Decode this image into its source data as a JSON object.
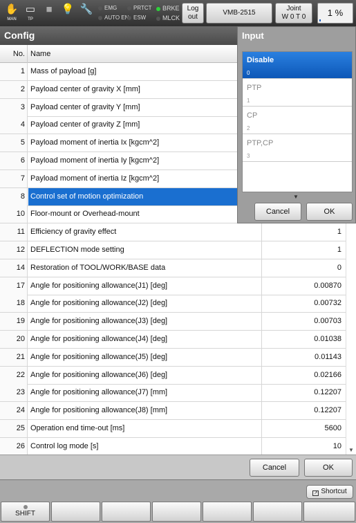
{
  "topbar": {
    "man_label": "MAN",
    "tp_label": "TP",
    "indicators": {
      "emg": "EMG",
      "auto_en": "AUTO EN",
      "prtct": "PRTCT",
      "esw": "ESW",
      "brke": "BRKE",
      "mlck": "MLCK"
    },
    "logout_line1": "Log",
    "logout_line2": "out",
    "robot_model": "VMB-2515",
    "joint_line1": "Joint",
    "joint_line2": "W 0 T 0",
    "speed_percent": "1 %",
    "speed_value": 1
  },
  "window_title": "Config",
  "table": {
    "col_no": "No.",
    "col_name": "Name",
    "rows": [
      {
        "no": "1",
        "name": "Mass of payload [g]",
        "value": ""
      },
      {
        "no": "2",
        "name": "Payload center of gravity X [mm]",
        "value": ""
      },
      {
        "no": "3",
        "name": "Payload center of gravity Y [mm]",
        "value": ""
      },
      {
        "no": "4",
        "name": "Payload center of gravity Z [mm]",
        "value": ""
      },
      {
        "no": "5",
        "name": "Payload moment of inertia Ix [kgcm^2]",
        "value": ""
      },
      {
        "no": "6",
        "name": "Payload moment of inertia Iy [kgcm^2]",
        "value": ""
      },
      {
        "no": "7",
        "name": "Payload moment of inertia Iz [kgcm^2]",
        "value": ""
      },
      {
        "no": "8",
        "name": "Control set of motion optimization",
        "value": ""
      },
      {
        "no": "10",
        "name": "Floor-mount or Overhead-mount",
        "value": ""
      },
      {
        "no": "11",
        "name": "Efficiency of gravity effect",
        "value": "1"
      },
      {
        "no": "12",
        "name": "DEFLECTION mode setting",
        "value": "1"
      },
      {
        "no": "14",
        "name": "Restoration of TOOL/WORK/BASE data",
        "value": "0"
      },
      {
        "no": "17",
        "name": "Angle for positioning allowance(J1) [deg]",
        "value": "0.00870"
      },
      {
        "no": "18",
        "name": "Angle for positioning allowance(J2) [deg]",
        "value": "0.00732"
      },
      {
        "no": "19",
        "name": "Angle for positioning allowance(J3) [deg]",
        "value": "0.00703"
      },
      {
        "no": "20",
        "name": "Angle for positioning allowance(J4) [deg]",
        "value": "0.01038"
      },
      {
        "no": "21",
        "name": "Angle for positioning allowance(J5) [deg]",
        "value": "0.01143"
      },
      {
        "no": "22",
        "name": "Angle for positioning allowance(J6) [deg]",
        "value": "0.02166"
      },
      {
        "no": "23",
        "name": "Angle for positioning allowance(J7) [mm]",
        "value": "0.12207"
      },
      {
        "no": "24",
        "name": "Angle for positioning allowance(J8) [mm]",
        "value": "0.12207"
      },
      {
        "no": "25",
        "name": "Operation end time-out  [ms]",
        "value": "5600"
      },
      {
        "no": "26",
        "name": "Control log mode [s]",
        "value": "10"
      }
    ]
  },
  "footer": {
    "cancel": "Cancel",
    "ok": "OK",
    "shortcut": "Shortcut",
    "shift": "SHIFT"
  },
  "popup": {
    "title": "Input",
    "options": [
      {
        "label": "Disable",
        "value": "0"
      },
      {
        "label": "PTP",
        "value": "1"
      },
      {
        "label": "CP",
        "value": "2"
      },
      {
        "label": "PTP,CP",
        "value": "3"
      }
    ],
    "cancel": "Cancel",
    "ok": "OK"
  },
  "colors": {
    "selection": "#1a6fd0",
    "brke_led": "#2fd13a"
  }
}
